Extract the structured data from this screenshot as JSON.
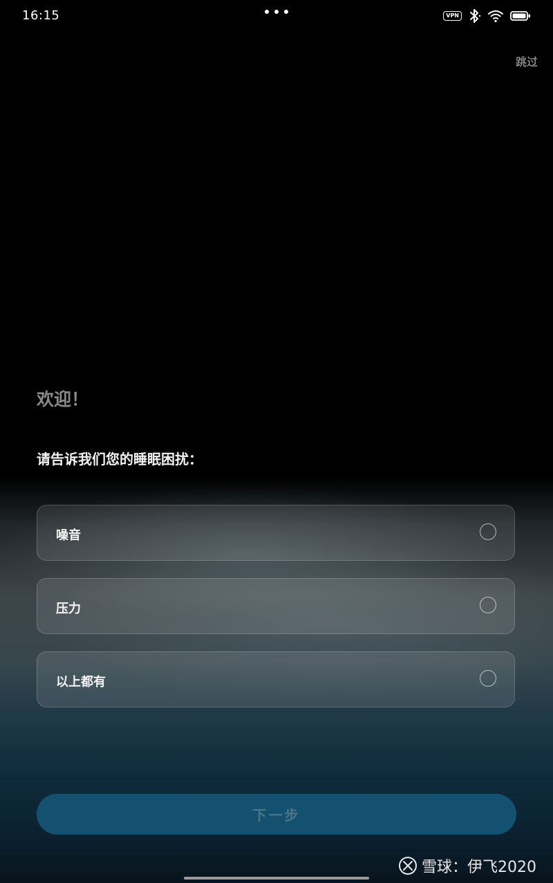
{
  "status_bar": {
    "time": "16:15",
    "vpn_label": "VPN",
    "icons": [
      "more-dots-icon",
      "vpn-icon",
      "bluetooth-icon",
      "wifi-icon",
      "battery-icon"
    ]
  },
  "header": {
    "skip_label": "跳过"
  },
  "main": {
    "welcome": "欢迎！",
    "question": "请告诉我们您的睡眠困扰：",
    "options": [
      {
        "label": "噪音",
        "selected": false
      },
      {
        "label": "压力",
        "selected": false
      },
      {
        "label": "以上都有",
        "selected": false
      }
    ],
    "next_label": "下一步"
  },
  "watermark": {
    "text": "雪球：伊飞2020",
    "icon": "xueqiu-logo-icon"
  },
  "colors": {
    "button_bg": "#14506f",
    "button_text": "#4b758a",
    "welcome_text": "#8a8a8a"
  }
}
